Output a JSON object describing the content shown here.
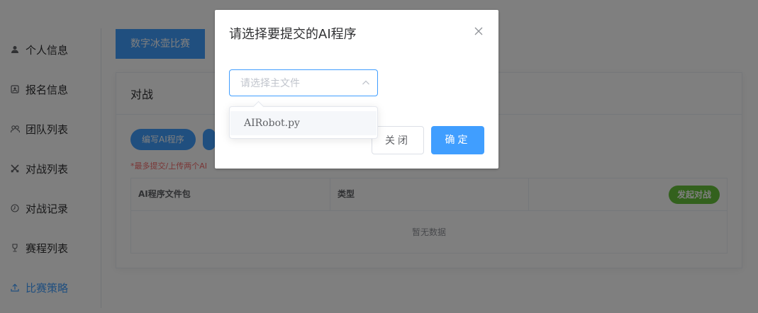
{
  "sidebar": {
    "items": [
      {
        "label": "个人信息",
        "icon": "user-icon"
      },
      {
        "label": "报名信息",
        "icon": "id-card-icon"
      },
      {
        "label": "团队列表",
        "icon": "team-icon"
      },
      {
        "label": "对战列表",
        "icon": "swords-icon"
      },
      {
        "label": "对战记录",
        "icon": "clock-icon"
      },
      {
        "label": "赛程列表",
        "icon": "trophy-icon"
      },
      {
        "label": "比赛策略",
        "icon": "upload-icon"
      }
    ],
    "active_index": 6
  },
  "tabs": [
    {
      "label": "数字冰壶比赛"
    }
  ],
  "card": {
    "title": "对战",
    "buttons": [
      {
        "label": "编写AI程序"
      }
    ],
    "warning": "*最多提交/上传两个AI",
    "table": {
      "columns": [
        "AI程序文件包",
        "类型",
        ""
      ],
      "action_label": "发起对战",
      "empty_text": "暂无数据"
    }
  },
  "dialog": {
    "title": "请选择要提交的AI程序",
    "select": {
      "placeholder": "请选择主文件",
      "options": [
        "AIRobot.py"
      ]
    },
    "close_label": "关闭",
    "confirm_label": "确定"
  },
  "colors": {
    "primary": "#409eff",
    "success": "#67c23a",
    "danger": "#f56c6c"
  }
}
